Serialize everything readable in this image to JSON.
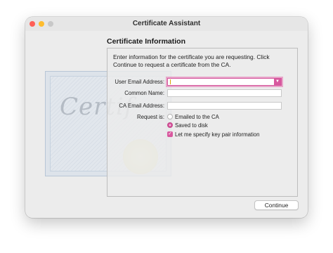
{
  "window": {
    "title": "Certificate Assistant"
  },
  "section": {
    "title": "Certificate Information"
  },
  "form": {
    "instructions": "Enter information for the certificate you are requesting. Click Continue to request a certificate from the CA.",
    "user_email_label": "User Email Address:",
    "user_email_value": "",
    "common_name_label": "Common Name:",
    "common_name_value": "",
    "ca_email_label": "CA Email Address:",
    "ca_email_value": "",
    "request_is_label": "Request is:",
    "options": {
      "emailed": "Emailed to the CA",
      "saved": "Saved to disk",
      "selected": "saved"
    },
    "key_pair_label": "Let me specify key pair information",
    "key_pair_checked": true
  },
  "buttons": {
    "continue": "Continue"
  },
  "illustration": {
    "text": "Certif"
  },
  "icons": {
    "dropdown": "chevron-down-icon",
    "check": "checkmark-icon"
  },
  "colors": {
    "accent": "#d8589f",
    "close": "#ff5f57",
    "minimize": "#febc2e",
    "zoom": "#c8c8c8"
  }
}
